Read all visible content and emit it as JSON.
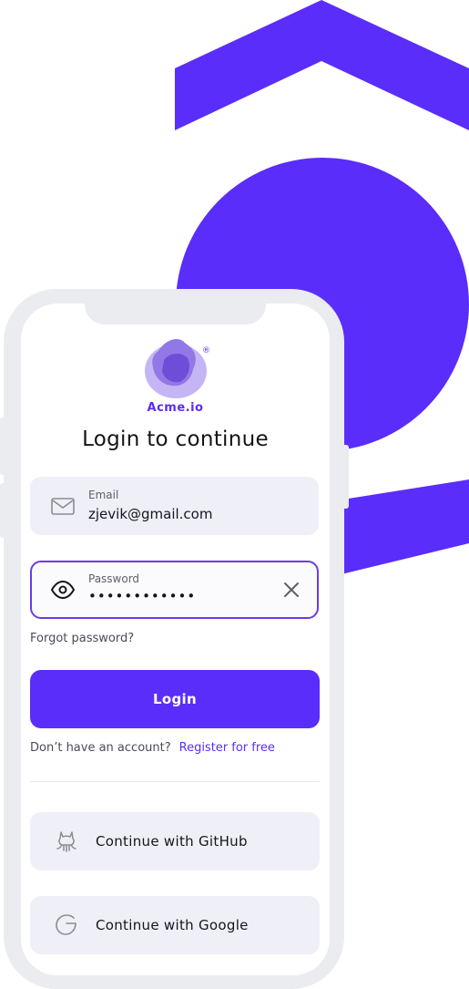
{
  "brand": {
    "name": "Acme.io",
    "registered_mark": "®",
    "accent_color": "#5a2dfa"
  },
  "heading": "Login to continue",
  "email_field": {
    "label": "Email",
    "value": "zjevik@gmail.com",
    "icon": "mail-icon"
  },
  "password_field": {
    "label": "Password",
    "value": "••••••••••••",
    "icon": "eye-icon",
    "clear_icon": "close-icon",
    "focused": true
  },
  "forgot_password": "Forgot password?",
  "login_button": "Login",
  "register": {
    "prompt": "Don’t have an account?",
    "link": "Register for free"
  },
  "social": [
    {
      "label": "Continue with GitHub",
      "icon": "github-icon"
    },
    {
      "label": "Continue with Google",
      "icon": "google-icon"
    }
  ]
}
